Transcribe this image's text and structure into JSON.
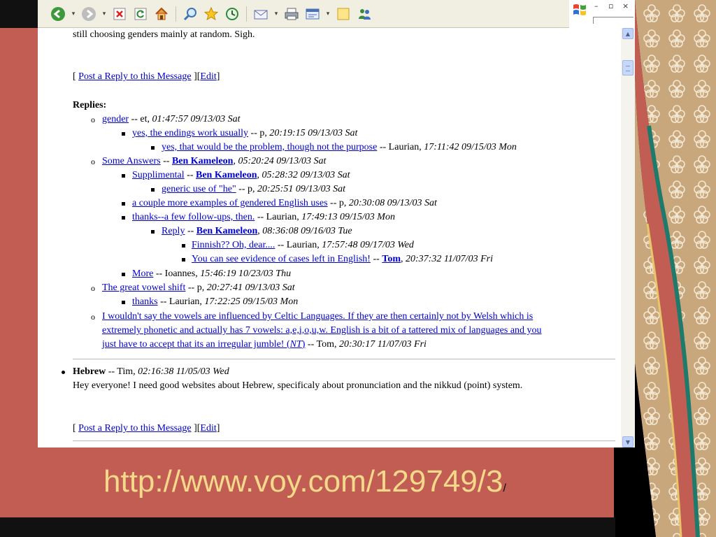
{
  "toolbar": {
    "icons": [
      "back-icon",
      "forward-icon",
      "stop-icon",
      "refresh-icon",
      "home-icon",
      "search-icon",
      "favorites-icon",
      "history-icon",
      "mail-icon",
      "print-icon",
      "edit-icon",
      "discuss-icon",
      "messenger-icon"
    ]
  },
  "window": {
    "minimize": "–",
    "restore": "▫",
    "close": "×"
  },
  "post1": {
    "body_end": "still choosing genders mainly at random. Sigh.",
    "reply_open": "[ ",
    "reply_link": "Post a Reply to this Message",
    "reply_mid": " ][",
    "edit_link": "Edit",
    "reply_close": "]"
  },
  "replies_label": "Replies:",
  "replies": [
    {
      "title": "gender",
      "sep": " -- ",
      "author": "et, ",
      "author_bold": false,
      "time": "01:47:57 09/13/03 Sat"
    },
    {
      "title": "yes, the endings work usually",
      "sep": " -- ",
      "author": "p, ",
      "author_bold": false,
      "time": "20:19:15 09/13/03 Sat"
    },
    {
      "title": "yes, that would be the problem, though not the purpose",
      "sep": " -- ",
      "author": "Laurian, ",
      "author_bold": false,
      "time": "17:11:42 09/15/03 Mon"
    },
    {
      "title": "Some Answers",
      "sep": " -- ",
      "author": "Ben Kameleon",
      "author_bold": true,
      "time": "05:20:24 09/13/03 Sat"
    },
    {
      "title": "Supplimental",
      "sep": " -- ",
      "author": "Ben Kameleon",
      "author_bold": true,
      "time": "05:28:32 09/13/03 Sat"
    },
    {
      "title": "generic use of \"he\"",
      "sep": " -- ",
      "author": "p, ",
      "author_bold": false,
      "time": "20:25:51 09/13/03 Sat"
    },
    {
      "title": "a couple more examples of gendered English uses",
      "sep": " -- ",
      "author": "p, ",
      "author_bold": false,
      "time": "20:30:08 09/13/03 Sat"
    },
    {
      "title": "thanks--a few follow-ups, then.",
      "sep": " -- ",
      "author": "Laurian, ",
      "author_bold": false,
      "time": "17:49:13 09/15/03 Mon"
    },
    {
      "title": "Reply",
      "sep": " -- ",
      "author": "Ben Kameleon",
      "author_bold": true,
      "time": "08:36:08 09/16/03 Tue"
    },
    {
      "title": "Finnish?? Oh, dear....",
      "sep": " -- ",
      "author": "Laurian, ",
      "author_bold": false,
      "time": "17:57:48 09/17/03 Wed"
    },
    {
      "title": "You can see evidence of cases left in English!",
      "sep": " -- ",
      "author": "Tom",
      "author_bold": true,
      "time": "20:37:32 11/07/03 Fri"
    },
    {
      "title": "More",
      "sep": " -- ",
      "author": "Ioannes, ",
      "author_bold": false,
      "time": "15:46:19 10/23/03 Thu"
    },
    {
      "title": "The great vowel shift",
      "sep": " -- ",
      "author": "p, ",
      "author_bold": false,
      "time": "20:27:41 09/13/03 Sat"
    },
    {
      "title": "thanks",
      "sep": " -- ",
      "author": "Laurian, ",
      "author_bold": false,
      "time": "17:22:25 09/15/03 Mon"
    }
  ],
  "long_reply": {
    "line1": "I wouldn't say the vowels are influenced by Celtic Languages. If they are then certainly not by Welsh which is",
    "line2": "extremely phonetic and actually has 7 vowels: a,e,i,o,u,w. English is a bit of a tattered mix of languages and you",
    "line3": "just have to accept that its an irregular jumble! (",
    "nt": "NT",
    "line3_close": ")",
    "sep": " -- ",
    "author": "Tom, ",
    "time": "20:30:17 11/07/03 Fri"
  },
  "post2": {
    "title": "Hebrew",
    "sep": " -- ",
    "author": "Tim, ",
    "time": "02:16:38 11/05/03 Wed",
    "body": "Hey everyone! I need good websites about Hebrew, specificaly about pronunciation and the nikkud (point) system.",
    "reply_open": "[ ",
    "reply_link": "Post a Reply to this Message",
    "reply_mid": " ][",
    "edit_link": "Edit",
    "reply_close": "]"
  },
  "caption": {
    "url": "http://www.voy.com/129749/3",
    "slash": "/"
  },
  "colors": {
    "slide_bg": "#c25d54",
    "link": "#0000cc",
    "caption": "#f5d98a"
  }
}
